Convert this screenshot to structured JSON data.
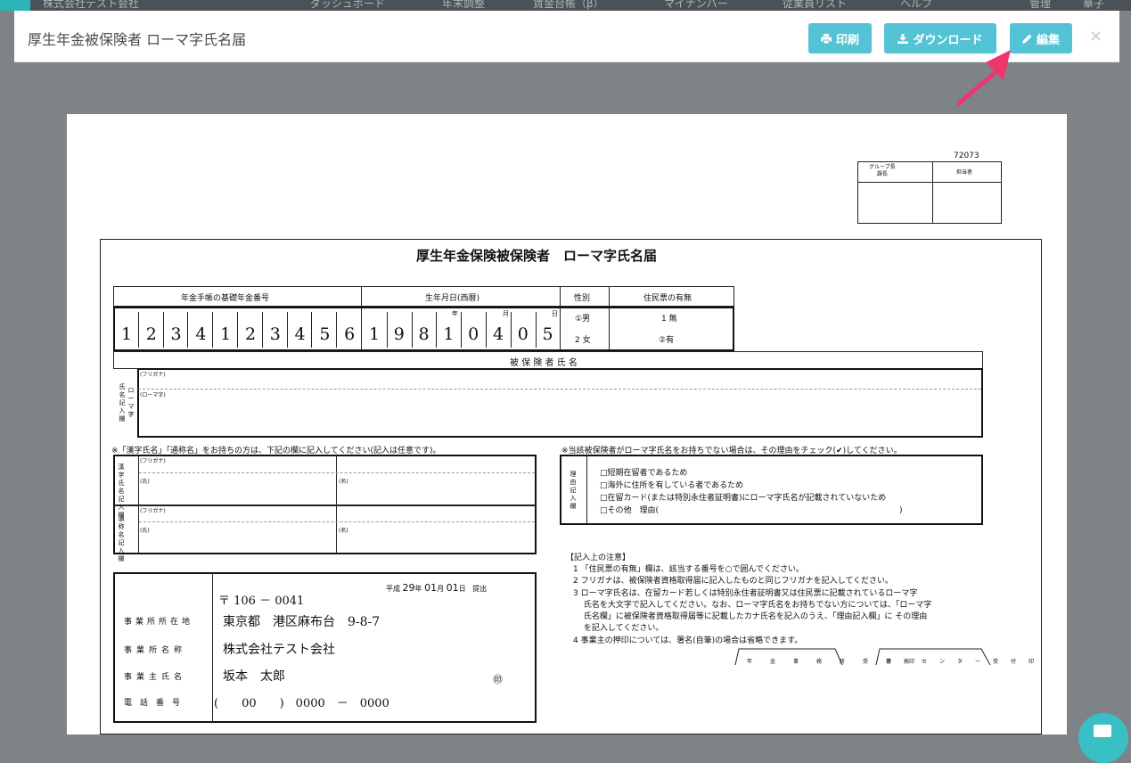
{
  "app_nav": {
    "company": "株式会社テスト会社",
    "items": [
      "ダッシュボード",
      "年末調整",
      "賃金台帳（β）",
      "マイナンバー",
      "従業員リスト",
      "ヘルプ",
      "管理",
      "華子"
    ]
  },
  "modal": {
    "title": "厚生年金被保険者 ローマ字氏名届",
    "print_label": "印刷",
    "download_label": "ダウンロード",
    "edit_label": "編集",
    "close_label": "×",
    "accent_color": "#55c3d6",
    "arrow_color": "#f0356e"
  },
  "form": {
    "form_code": "72073",
    "approval": {
      "group_head": "グループ長\n課長",
      "staff": "担当者"
    },
    "title": "厚生年金保険被保険者　ローマ字氏名届",
    "pension_header": "年金手帳の基礎年金番号",
    "pension_digits": [
      "1",
      "2",
      "3",
      "4",
      "1",
      "2",
      "3",
      "4",
      "5",
      "6"
    ],
    "birth_header": "生年月日(西暦)",
    "birth_digits": [
      "1",
      "9",
      "8",
      "1",
      "0",
      "4",
      "0",
      "5"
    ],
    "birth_units": [
      "年",
      "月",
      "日"
    ],
    "gender_header": "性別",
    "gender_options": [
      "①男",
      "2 女"
    ],
    "residence_header": "住民票の有無",
    "residence_options": [
      "1 無",
      "②有"
    ],
    "insured_name_header": "被 保 険 者 氏 名",
    "name_row_label": "氏名記入欄",
    "roman_label": "ローマ字",
    "furigana_label": "(フリガナ)",
    "roman_sub_label": "(ローマ字)",
    "kanji_note": "※「漢字氏名」「通称名」をお持ちの方は、下記の欄に記入してください(記入は任意です)。",
    "kanji_label": "漢字氏名記入欄",
    "alias_label": "通称名記入欄",
    "surname_label": "(氏)",
    "given_label": "(名)",
    "reason_note": "※当該被保険者がローマ字氏名をお持ちでない場合は、その理由をチェック(✔)してください。",
    "reason_label": "理由記入欄",
    "reasons": [
      "□短期在留者であるため",
      "□海外に住所を有している者であるため",
      "□在留カード(または特別永住者証明書)にローマ字氏名が記載されていないため",
      "□その他　理由(　　　　　　　　　　　　　　　　　　　　　　　　　　　　　　)"
    ],
    "submit_date": {
      "era": "平成",
      "year": "29",
      "year_unit": "年",
      "month": "01",
      "month_unit": "月",
      "day": "01",
      "day_unit": "日",
      "label": "提出"
    },
    "postal": "〒 106 － 0041",
    "office_address_label": "事業所所在地",
    "office_address": "東京都　港区麻布台　9-8-7",
    "office_name_label": "事業所名称",
    "office_name": "株式会社テスト会社",
    "owner_label": "事業主氏名",
    "owner_name": "坂本　太郎",
    "seal": "㊞",
    "phone_label": "電話番号",
    "phone": "(　　00　　)　0000　－　0000",
    "notes_title": "【記入上の注意】",
    "notes": [
      "1 「住民票の有無」欄は、該当する番号を○で囲んでください。",
      "2 フリガナは、被保険者資格取得届に記入したものと同じフリガナを記入してください。",
      "3 ローマ字氏名は、在留カード若しくは特別永住者証明書又は住民票に記載されているローマ字",
      "　 氏名を大文字で記入してください。なお、ローマ字氏名をお持ちでない方については、「ローマ字",
      "　 氏名欄」に被保険者資格取得届等に記載したカナ氏名を記入のうえ、「理由記入欄」に その理由",
      "　 を記入してください。",
      "4 事業主の押印については、署名(自筆)の場合は省略できます。"
    ],
    "stamp_office": "年金事務所受付印",
    "stamp_center": "事務センター受付印"
  }
}
